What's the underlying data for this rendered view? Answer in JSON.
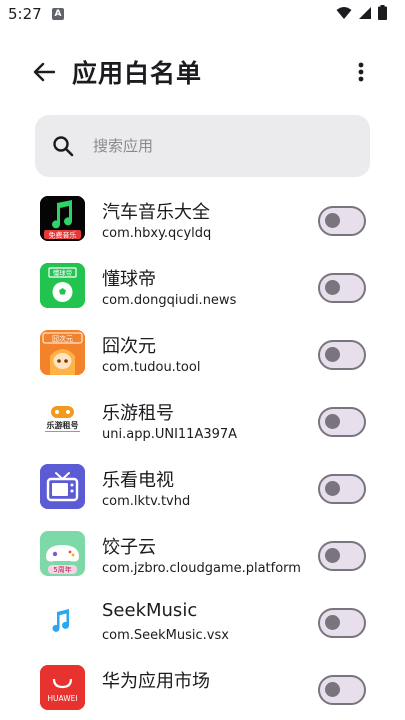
{
  "status_bar": {
    "time": "5:27",
    "notification_badge": "A",
    "icons": [
      "wifi-icon",
      "signal-icon",
      "battery-icon"
    ]
  },
  "header": {
    "title": "应用白名单",
    "back_icon": "arrow-back-icon",
    "more_icon": "more-vert-icon"
  },
  "search": {
    "placeholder": "搜索应用",
    "value": ""
  },
  "colors": {
    "toggle_border": "#79747e",
    "toggle_track": "#e7e0ec",
    "search_bg": "#ebebee"
  },
  "apps": [
    {
      "name": "汽车音乐大全",
      "package": "com.hbxy.qcyldq",
      "icon": "music-app-icon",
      "icon_text": "免费音乐",
      "enabled": false
    },
    {
      "name": "懂球帝",
      "package": "com.dongqiudi.news",
      "icon": "soccer-app-icon",
      "icon_text": "懂球帝",
      "enabled": false
    },
    {
      "name": "囧次元",
      "package": "com.tudou.tool",
      "icon": "anime-app-icon",
      "icon_text": "囧次元",
      "enabled": false
    },
    {
      "name": "乐游租号",
      "package": "uni.app.UNI11A397A",
      "icon": "game-rental-icon",
      "icon_text": "乐游租号",
      "enabled": false
    },
    {
      "name": "乐看电视",
      "package": "com.lktv.tvhd",
      "icon": "tv-app-icon",
      "icon_text": "",
      "enabled": false
    },
    {
      "name": "饺子云",
      "package": "com.jzbro.cloudgame.platform",
      "icon": "cloud-game-icon",
      "icon_text": "5周年",
      "enabled": false
    },
    {
      "name": "SeekMusic",
      "package": "com.SeekMusic.vsx",
      "icon": "seek-music-icon",
      "icon_text": "",
      "enabled": false
    },
    {
      "name": "华为应用市场",
      "package": "",
      "icon": "huawei-appgallery-icon",
      "icon_text": "HUAWEI",
      "enabled": false
    }
  ]
}
